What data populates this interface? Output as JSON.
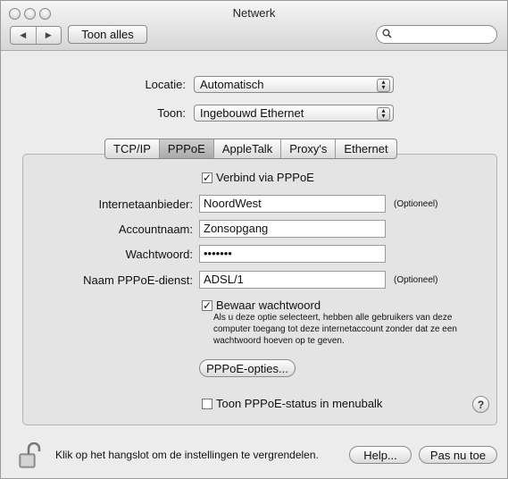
{
  "window": {
    "title": "Netwerk"
  },
  "toolbar": {
    "back_label": "◀",
    "forward_label": "▶",
    "show_all_label": "Toon alles",
    "search_value": ""
  },
  "location": {
    "label": "Locatie:",
    "value": "Automatisch"
  },
  "show": {
    "label": "Toon:",
    "value": "Ingebouwd Ethernet"
  },
  "tabs": [
    {
      "label": "TCP/IP",
      "selected": false
    },
    {
      "label": "PPPoE",
      "selected": true
    },
    {
      "label": "AppleTalk",
      "selected": false
    },
    {
      "label": "Proxy's",
      "selected": false
    },
    {
      "label": "Ethernet",
      "selected": false
    }
  ],
  "pppoe": {
    "connect_label": "Verbind via PPPoE",
    "connect_checked": true,
    "provider": {
      "label": "Internetaanbieder:",
      "value": "NoordWest",
      "hint": "(Optioneel)"
    },
    "account": {
      "label": "Accountnaam:",
      "value": "Zonsopgang"
    },
    "password": {
      "label": "Wachtwoord:",
      "value": "•••••••"
    },
    "service": {
      "label": "Naam PPPoE-dienst:",
      "value": "ADSL/1",
      "hint": "(Optioneel)"
    },
    "save_password_label": "Bewaar wachtwoord",
    "save_password_checked": true,
    "save_password_desc": "Als u deze optie selecteert, hebben alle gebruikers van deze computer toegang tot deze internetaccount zonder dat ze een wachtwoord hoeven op te geven.",
    "options_button": "PPPoE-opties...",
    "status_label": "Toon PPPoE-status in menubalk",
    "status_checked": false,
    "help_label": "?"
  },
  "footer": {
    "lock_text": "Klik op het hangslot om de instellingen te vergrendelen.",
    "help_button": "Help...",
    "apply_button": "Pas nu toe"
  },
  "colors": {
    "window_bg": "#ececec",
    "panel_bg": "#e4e4e4",
    "field_bg": "#ffffff"
  }
}
